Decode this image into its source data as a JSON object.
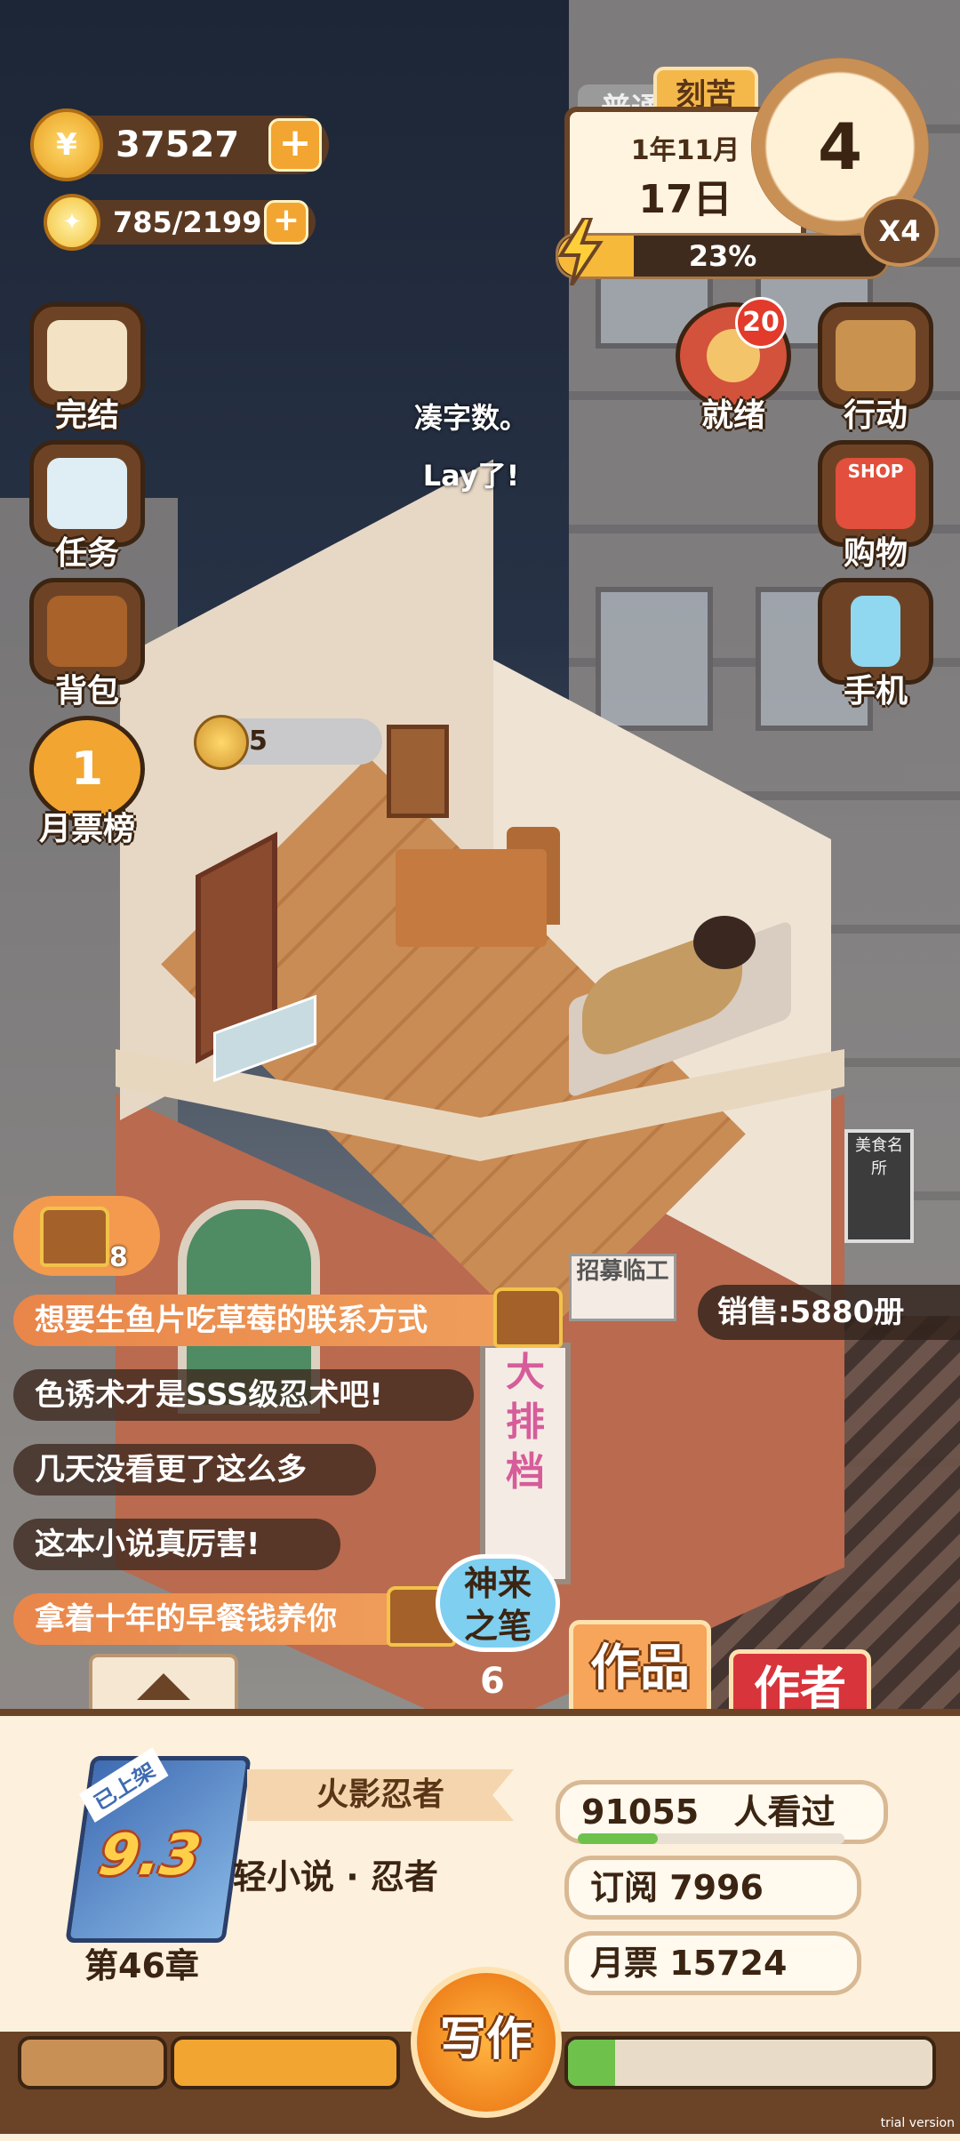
{
  "resources": {
    "coins": "37527",
    "inspiration": "785/2199",
    "coin_icon": "coin-icon",
    "bulb_icon": "lightbulb-icon",
    "plus": "+"
  },
  "calendar": {
    "tab_normal": "普通",
    "tab_hard": "刻苦",
    "year_month": "1年11月",
    "day": "17日",
    "energy_percent_label": "23%",
    "energy_fraction": 0.23,
    "clock_number": "4",
    "speed": "X4"
  },
  "left_menu": [
    {
      "label": "完结",
      "icon": "book-icon"
    },
    {
      "label": "任务",
      "icon": "checklist-icon"
    },
    {
      "label": "背包",
      "icon": "backpack-icon"
    },
    {
      "label": "月票榜",
      "icon": "medal-icon",
      "medal_number": "1"
    }
  ],
  "right_menu": {
    "ready": {
      "label": "就绪",
      "badge": "20"
    },
    "action": {
      "label": "行动"
    },
    "shop": {
      "label": "购物",
      "sign": "SHOP"
    },
    "phone": {
      "label": "手机"
    }
  },
  "float_text": {
    "line1": "凑字数。",
    "line2": "Lay了!"
  },
  "room_bubble": {
    "count": "5"
  },
  "building_signs": {
    "vertical": [
      "大",
      "排",
      "档"
    ],
    "recruit": "招募临工",
    "wall": "美食名所"
  },
  "chest_button": {
    "count": "8"
  },
  "sales": "销售:5880册",
  "comments": [
    {
      "text": "想要生鱼片吃草莓的联系方式",
      "style": "gold",
      "chest": true
    },
    {
      "text": "色诱术才是SSS级忍术吧!",
      "style": "dark",
      "chest": false
    },
    {
      "text": "几天没看更了这么多",
      "style": "dark",
      "chest": false
    },
    {
      "text": "这本小说真厉害!",
      "style": "dark",
      "chest": false
    },
    {
      "text": "拿着十年的早餐钱养你",
      "style": "gold",
      "chest": true
    }
  ],
  "skill": {
    "label_line1": "神来",
    "label_line2": "之笔",
    "count": "6"
  },
  "tabs": {
    "works": "作品",
    "author": "作者"
  },
  "book": {
    "shelf_tag": "已上架",
    "score": "9.3",
    "chapter": "第46章",
    "title": "火影忍者",
    "genre": "轻小说 · 忍者",
    "readers_number": "91055",
    "readers_label": "人看过",
    "readers_fraction": 0.3,
    "subscribe": "订阅 7996",
    "monthly_votes": "月票 15724"
  },
  "write_button": "写作",
  "progress_fraction": 0.13,
  "watermark": "trial version",
  "colors": {
    "accent_orange": "#f2a531",
    "panel_bg": "#fdf0dc",
    "brown": "#6b4326",
    "author_red": "#d8343c",
    "read_green": "#6ec24b"
  }
}
